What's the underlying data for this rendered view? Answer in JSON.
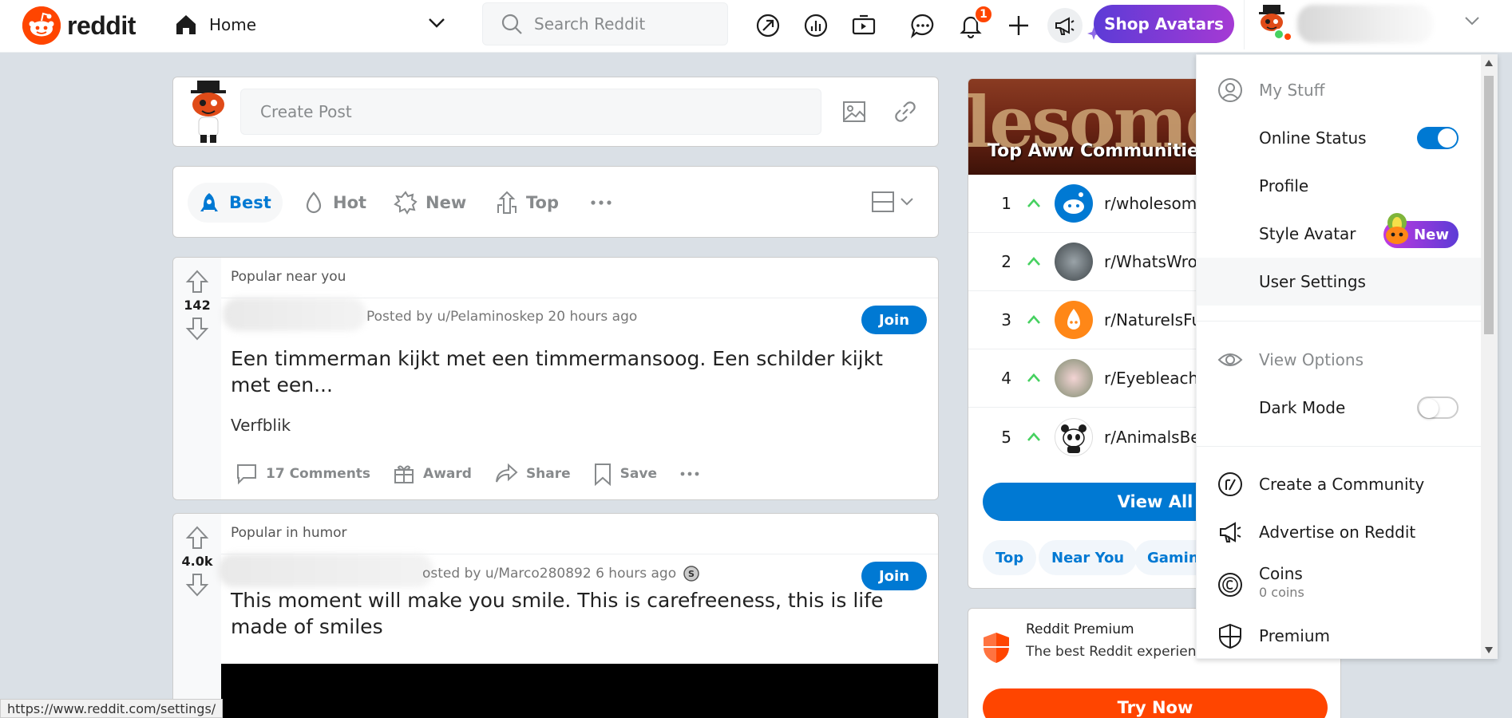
{
  "header": {
    "logo_text": "reddit",
    "home_label": "Home",
    "search_placeholder": "Search Reddit",
    "notification_count": "1",
    "shop_avatars_label": "Shop Avatars",
    "icons": [
      "popular-icon",
      "stats-icon",
      "video-icon",
      "chat-icon",
      "bell-icon",
      "plus-icon",
      "megaphone-icon"
    ]
  },
  "create_post": {
    "placeholder": "Create Post"
  },
  "sort": {
    "tabs": [
      "Best",
      "Hot",
      "New",
      "Top"
    ],
    "active": "Best"
  },
  "posts": [
    {
      "context": "Popular near you",
      "votes": "142",
      "byline": "Posted by u/Pelaminoskep 20 hours ago",
      "join_label": "Join",
      "title": "Een timmerman kijkt met een timmermansoog. Een schilder kijkt met een...",
      "body": "Verfblik",
      "actions": {
        "comments": "17 Comments",
        "award": "Award",
        "share": "Share",
        "save": "Save"
      }
    },
    {
      "context": "Popular in humor",
      "votes": "4.0k",
      "byline": "osted by u/Marco280892 6 hours ago",
      "join_label": "Join",
      "title": "This moment will make you smile. This is carefreeness, this is life made of smiles"
    }
  ],
  "sidebar": {
    "banner_text": "lesome",
    "title": "Top  Aww  Communities",
    "communities": [
      {
        "rank": "1",
        "name": "r/wholesome"
      },
      {
        "rank": "2",
        "name": "r/WhatsWron"
      },
      {
        "rank": "3",
        "name": "r/NatureIsFu"
      },
      {
        "rank": "4",
        "name": "r/Eyebleach"
      },
      {
        "rank": "5",
        "name": "r/AnimalsBei"
      }
    ],
    "view_all_label": "View All",
    "pills": [
      "Top",
      "Near You",
      "Gaming"
    ],
    "premium": {
      "title": "Reddit Premium",
      "subtitle": "The best Reddit experience Coins",
      "button_label": "Try Now"
    }
  },
  "dropdown": {
    "my_stuff_label": "My Stuff",
    "online_status_label": "Online Status",
    "online_status_on": true,
    "profile_label": "Profile",
    "style_avatar_label": "Style Avatar",
    "new_badge": "New",
    "user_settings_label": "User Settings",
    "view_options_label": "View Options",
    "dark_mode_label": "Dark Mode",
    "dark_mode_on": false,
    "create_community_label": "Create a Community",
    "advertise_label": "Advertise on Reddit",
    "coins_label": "Coins",
    "coins_value": "0 coins",
    "premium_label": "Premium"
  },
  "status_bar_url": "https://www.reddit.com/settings/",
  "colors": {
    "brand": "#ff4500",
    "accent": "#0079d3",
    "background": "#dae0e6"
  }
}
